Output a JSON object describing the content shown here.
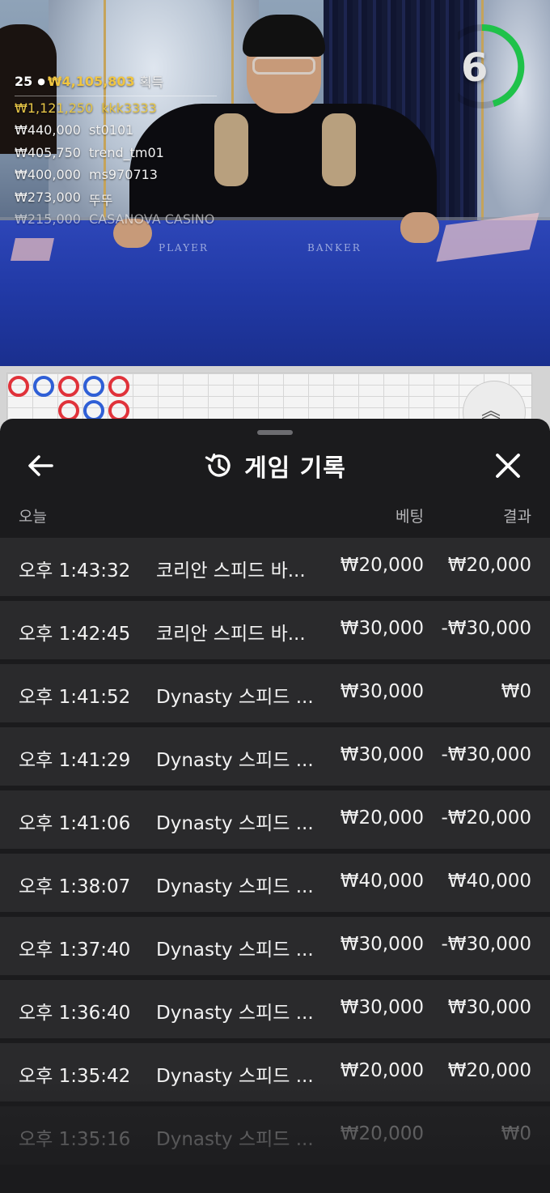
{
  "live_stream": {
    "table_labels": {
      "player": "PLAYER",
      "banker": "BANKER"
    },
    "countdown": "6",
    "winners": {
      "count": "25",
      "total": "₩4,105,803",
      "suffix": "획득",
      "rows": [
        {
          "amount": "₩1,121,250",
          "user": "kkk3333"
        },
        {
          "amount": "₩440,000",
          "user": "st0101"
        },
        {
          "amount": "₩405,750",
          "user": "trend_tm01"
        },
        {
          "amount": "₩400,000",
          "user": "ms970713"
        },
        {
          "amount": "₩273,000",
          "user": "뚜뚜"
        },
        {
          "amount": "₩215,000",
          "user": "CASANOVA CASINO"
        }
      ]
    }
  },
  "history_sheet": {
    "title": "게임 기록",
    "columns": {
      "date": "오늘",
      "bet": "베팅",
      "result": "결과"
    },
    "rows": [
      {
        "time": "오후 1:43:32",
        "game": "코리안 스피드 바...",
        "bet": "₩20,000",
        "result": "₩20,000"
      },
      {
        "time": "오후 1:42:45",
        "game": "코리안 스피드 바...",
        "bet": "₩30,000",
        "result": "-₩30,000"
      },
      {
        "time": "오후 1:41:52",
        "game": "Dynasty 스피드 ...",
        "bet": "₩30,000",
        "result": "₩0"
      },
      {
        "time": "오후 1:41:29",
        "game": "Dynasty 스피드 ...",
        "bet": "₩30,000",
        "result": "-₩30,000"
      },
      {
        "time": "오후 1:41:06",
        "game": "Dynasty 스피드 ...",
        "bet": "₩20,000",
        "result": "-₩20,000"
      },
      {
        "time": "오후 1:38:07",
        "game": "Dynasty 스피드 ...",
        "bet": "₩40,000",
        "result": "₩40,000"
      },
      {
        "time": "오후 1:37:40",
        "game": "Dynasty 스피드 ...",
        "bet": "₩30,000",
        "result": "-₩30,000"
      },
      {
        "time": "오후 1:36:40",
        "game": "Dynasty 스피드 ...",
        "bet": "₩30,000",
        "result": "₩30,000"
      },
      {
        "time": "오후 1:35:42",
        "game": "Dynasty 스피드 ...",
        "bet": "₩20,000",
        "result": "₩20,000"
      },
      {
        "time": "오후 1:35:16",
        "game": "Dynasty 스피드 ...",
        "bet": "₩20,000",
        "result": "₩0"
      }
    ]
  },
  "colors": {
    "accent_gold": "#f0c541",
    "timer_green": "#1fc24a",
    "road_player": "#2f5fd6",
    "road_banker": "#e0323a"
  }
}
